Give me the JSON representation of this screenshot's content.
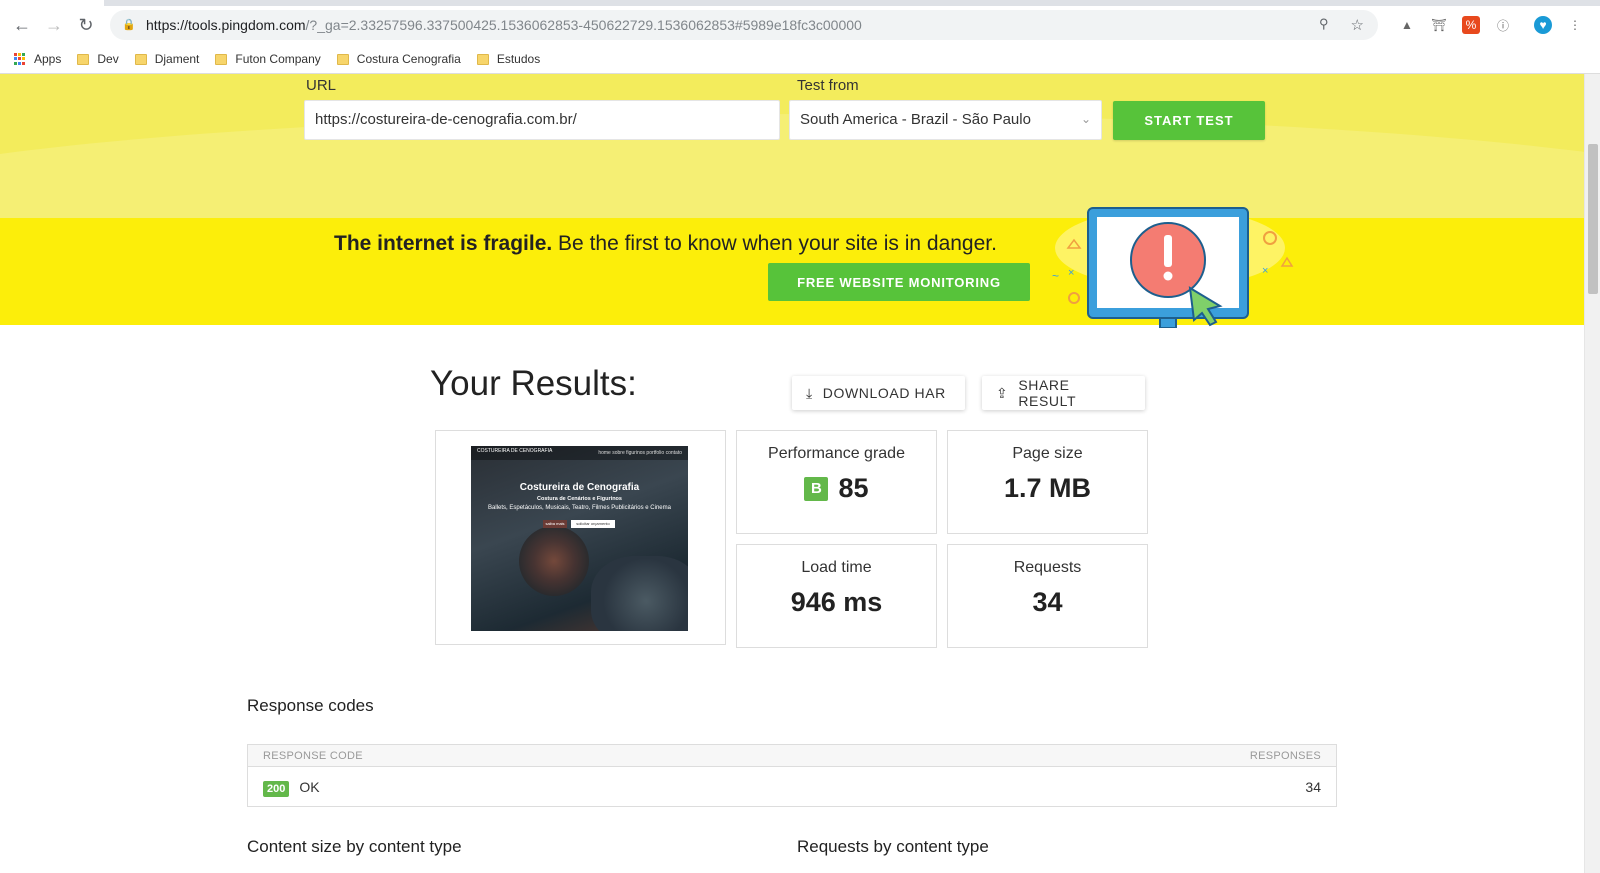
{
  "browser": {
    "url_host": "https://tools.pingdom.com",
    "url_rest": "/?_ga=2.33257596.337500425.1536062853-450622729.1536062853#5989e18fc3c00000",
    "bookmarks": [
      "Apps",
      "Dev",
      "Djament",
      "Futon Company",
      "Costura Cenografia",
      "Estudos"
    ],
    "ext_colors": {
      "office": "#e8491d",
      "blue_ext": "#1a9ad6"
    }
  },
  "form": {
    "url_label": "URL",
    "url_value": "https://costureira-de-cenografia.com.br/",
    "test_from_label": "Test from",
    "test_from_value": "South America - Brazil - São Paulo",
    "start_button": "START TEST"
  },
  "banner": {
    "strong": "The internet is fragile.",
    "text": " Be the first to know when your site is in danger.",
    "button": "FREE WEBSITE MONITORING"
  },
  "results": {
    "title": "Your Results:",
    "download_har": "DOWNLOAD HAR",
    "share_result": "SHARE RESULT",
    "performance_grade_label": "Performance grade",
    "grade_letter": "B",
    "grade_value": "85",
    "page_size_label": "Page size",
    "page_size_value": "1.7 MB",
    "load_time_label": "Load time",
    "load_time_value": "946 ms",
    "requests_label": "Requests",
    "requests_value": "34"
  },
  "screenshot": {
    "logo": "COSTUREIRA DE CENOGRAFIA",
    "nav": "home  sobre  figurinos  portfolio  contato",
    "title": "Costureira de Cenografia",
    "subtitle": "Costura de Cenários e Figurinos",
    "subtitle2": "Ballets, Espetáculos, Musicais, Teatro, Filmes Publicitários e Cinema",
    "btn1": "saiba mais",
    "btn2": "solicitar orçamento"
  },
  "response_codes": {
    "title": "Response codes",
    "col_code": "RESPONSE CODE",
    "col_responses": "RESPONSES",
    "rows": [
      {
        "code": "200",
        "status": "OK",
        "count": "34"
      }
    ]
  },
  "bottom": {
    "content_size_title": "Content size by content type",
    "requests_title": "Requests by content type"
  },
  "colors": {
    "green": "#57c33a",
    "yellow": "#fcee0a",
    "light_yellow": "#f3ec5c"
  }
}
